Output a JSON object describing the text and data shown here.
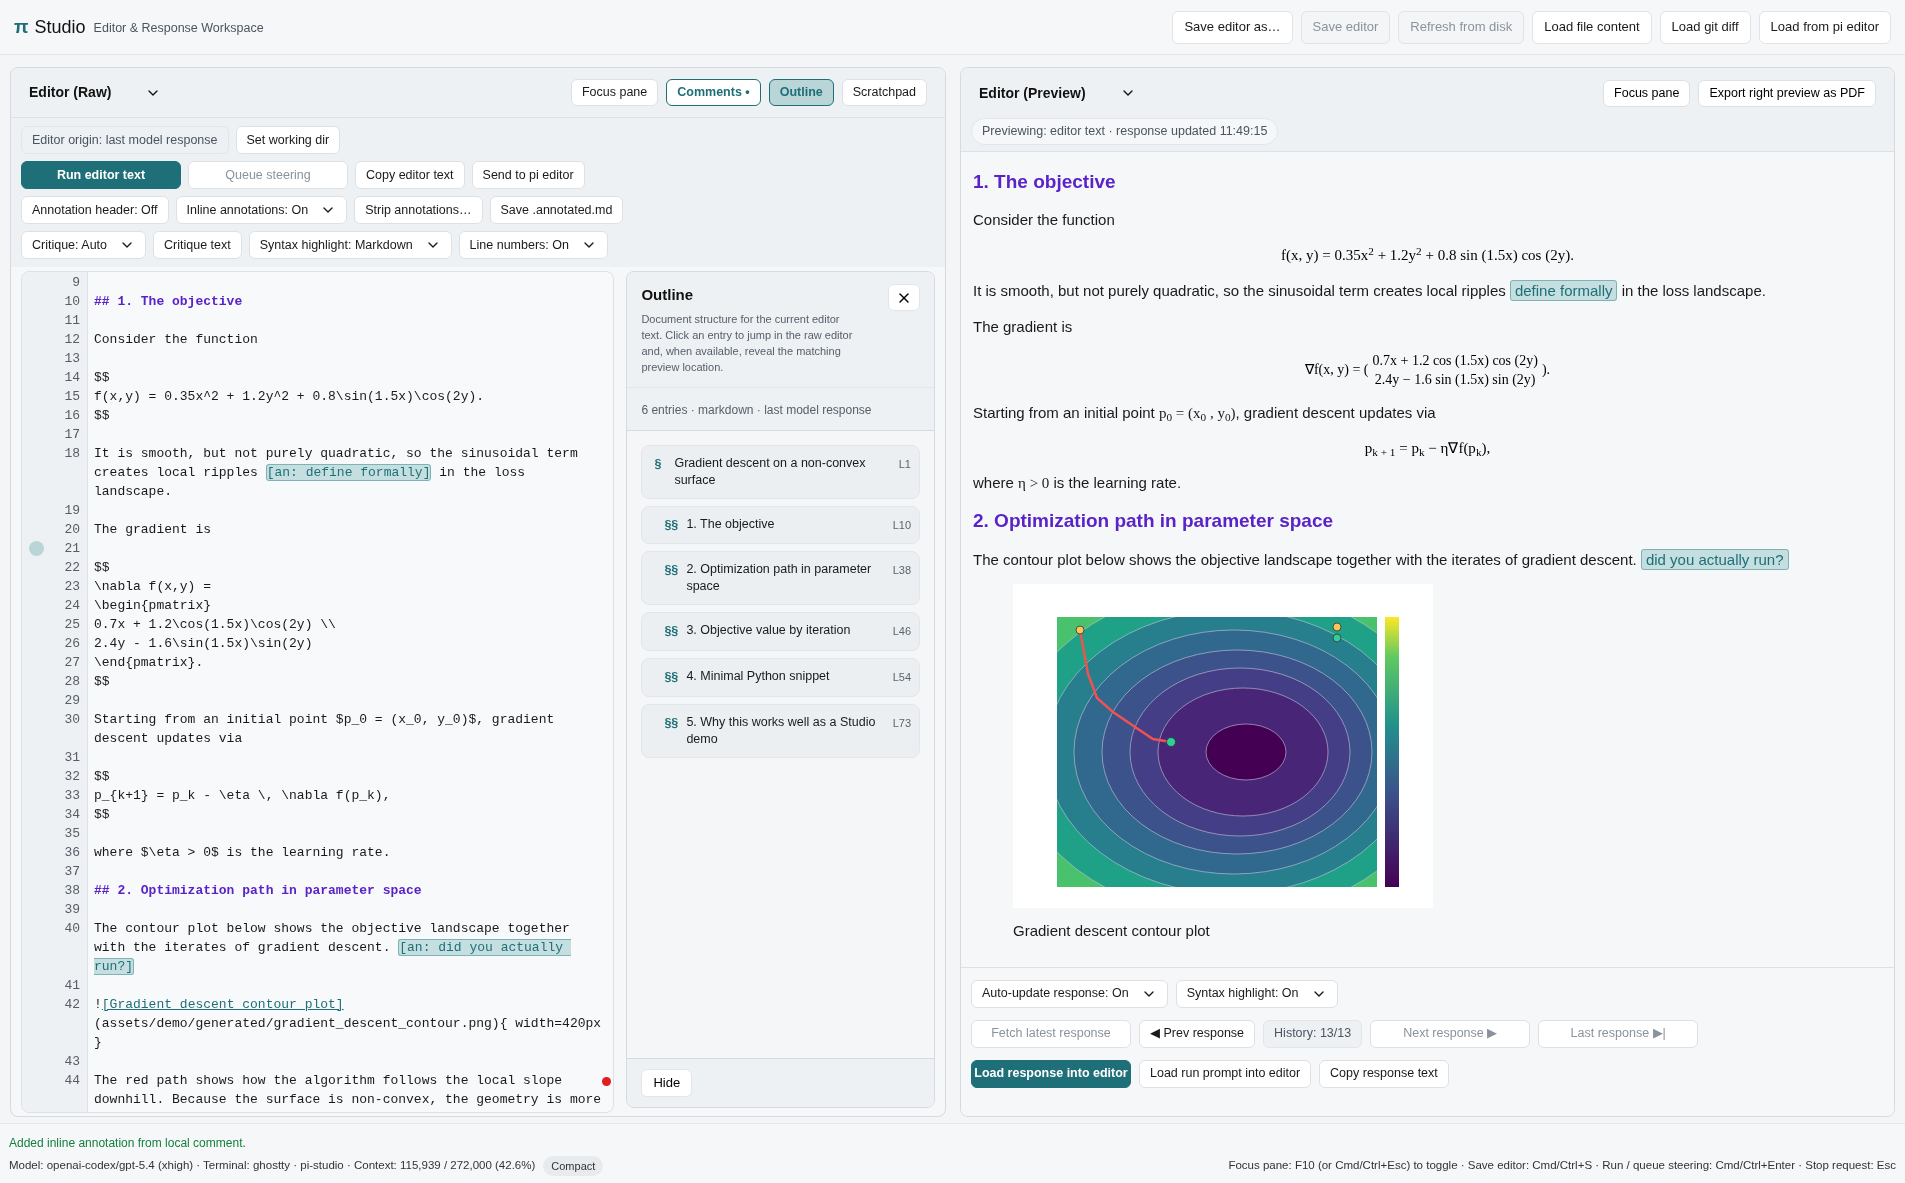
{
  "app": {
    "logo": "π",
    "title": "Studio",
    "subtitle": "Editor & Response Workspace"
  },
  "top_buttons": [
    {
      "label": "Save editor as…",
      "disabled": false
    },
    {
      "label": "Save editor",
      "disabled": true
    },
    {
      "label": "Refresh from disk",
      "disabled": true
    },
    {
      "label": "Load file content",
      "disabled": false
    },
    {
      "label": "Load git diff",
      "disabled": false
    },
    {
      "label": "Load from pi editor",
      "disabled": false
    }
  ],
  "editor": {
    "title": "Editor (Raw)",
    "header_buttons": [
      {
        "label": "Focus pane",
        "kind": "button"
      },
      {
        "label": "Comments •",
        "kind": "toggle",
        "on": true
      },
      {
        "label": "Outline",
        "kind": "panel",
        "on": true
      },
      {
        "label": "Scratchpad",
        "kind": "button"
      }
    ],
    "toolbar": [
      [
        {
          "kind": "pill",
          "label": "Editor origin: last model response"
        },
        {
          "kind": "button",
          "label": "Set working dir",
          "disabled": false
        }
      ],
      [
        {
          "kind": "primary",
          "label": "Run editor text",
          "disabled": false
        },
        {
          "kind": "button",
          "label": "Queue steering",
          "disabled": true
        },
        {
          "kind": "button",
          "label": "Copy editor text",
          "disabled": false
        },
        {
          "kind": "button",
          "label": "Send to pi editor",
          "disabled": false
        }
      ],
      [
        {
          "kind": "button",
          "label": "Annotation header: Off",
          "disabled": false
        },
        {
          "kind": "select",
          "label": "Inline annotations: On"
        },
        {
          "kind": "button",
          "label": "Strip annotations…",
          "disabled": false
        },
        {
          "kind": "button",
          "label": "Save .annotated.md",
          "disabled": false
        }
      ],
      [
        {
          "kind": "select",
          "label": "Critique: Auto"
        },
        {
          "kind": "button",
          "label": "Critique text",
          "disabled": false
        },
        {
          "kind": "select",
          "label": "Syntax highlight: Markdown"
        },
        {
          "kind": "select",
          "label": "Line numbers: On"
        }
      ]
    ],
    "lines": [
      {
        "n": "9"
      },
      {
        "n": "10",
        "tokens": [
          {
            "kind": "heading",
            "text": "## 1. The objective"
          }
        ]
      },
      {
        "n": "11"
      },
      {
        "n": "12",
        "tokens": [
          {
            "kind": "text",
            "text": "Consider the function"
          }
        ]
      },
      {
        "n": "13"
      },
      {
        "n": "14",
        "tokens": [
          {
            "kind": "text",
            "text": "$$"
          }
        ]
      },
      {
        "n": "15",
        "tokens": [
          {
            "kind": "text",
            "text": "f(x,y) = 0.35x^2 + 1.2y^2 + 0.8\\sin(1.5x)\\cos(2y)."
          }
        ]
      },
      {
        "n": "16",
        "tokens": [
          {
            "kind": "text",
            "text": "$$"
          }
        ]
      },
      {
        "n": "17"
      },
      {
        "n": "18",
        "tokens": [
          {
            "kind": "text",
            "text": "It is smooth, but not purely quadratic, so the sinusoidal term creates local ripples "
          },
          {
            "kind": "annotation",
            "text": "[an: define formally]"
          },
          {
            "kind": "text",
            "text": " in the loss landscape."
          }
        ]
      },
      {
        "n": "19"
      },
      {
        "n": "20",
        "tokens": [
          {
            "kind": "text",
            "text": "The gradient is"
          }
        ]
      },
      {
        "n": "21",
        "comment": true
      },
      {
        "n": "22",
        "tokens": [
          {
            "kind": "text",
            "text": "$$"
          }
        ]
      },
      {
        "n": "23",
        "tokens": [
          {
            "kind": "text",
            "text": "\\nabla f(x,y) ="
          }
        ]
      },
      {
        "n": "24",
        "tokens": [
          {
            "kind": "text",
            "text": "\\begin{pmatrix}"
          }
        ]
      },
      {
        "n": "25",
        "tokens": [
          {
            "kind": "text",
            "text": "0.7x + 1.2\\cos(1.5x)\\cos(2y) \\\\"
          }
        ]
      },
      {
        "n": "26",
        "tokens": [
          {
            "kind": "text",
            "text": "2.4y - 1.6\\sin(1.5x)\\sin(2y)"
          }
        ]
      },
      {
        "n": "27",
        "tokens": [
          {
            "kind": "text",
            "text": "\\end{pmatrix}."
          }
        ]
      },
      {
        "n": "28",
        "tokens": [
          {
            "kind": "text",
            "text": "$$"
          }
        ]
      },
      {
        "n": "29"
      },
      {
        "n": "30",
        "tokens": [
          {
            "kind": "text",
            "text": "Starting from an initial point $p_0 = (x_0, y_0)$, gradient descent updates via"
          }
        ]
      },
      {
        "n": "31"
      },
      {
        "n": "32",
        "tokens": [
          {
            "kind": "text",
            "text": "$$"
          }
        ]
      },
      {
        "n": "33",
        "tokens": [
          {
            "kind": "text",
            "text": "p_{k+1} = p_k - \\eta \\, \\nabla f(p_k),"
          }
        ]
      },
      {
        "n": "34",
        "tokens": [
          {
            "kind": "text",
            "text": "$$"
          }
        ]
      },
      {
        "n": "35"
      },
      {
        "n": "36",
        "tokens": [
          {
            "kind": "text",
            "text": "where $\\eta > 0$ is the learning rate."
          }
        ]
      },
      {
        "n": "37"
      },
      {
        "n": "38",
        "tokens": [
          {
            "kind": "heading",
            "text": "## 2. Optimization path in parameter space"
          }
        ]
      },
      {
        "n": "39"
      },
      {
        "n": "40",
        "tokens": [
          {
            "kind": "text",
            "text": "The contour plot below shows the objective landscape together with the iterates of gradient descent. "
          },
          {
            "kind": "annotation",
            "text": "[an: did you actually run?]"
          }
        ]
      },
      {
        "n": "41"
      },
      {
        "n": "42",
        "tokens": [
          {
            "kind": "text",
            "text": "!"
          },
          {
            "kind": "link",
            "text": "[Gradient descent contour plot]"
          },
          {
            "kind": "text",
            "text": "(assets/demo/generated/gradient_descent_contour.png){ width=420px }"
          }
        ]
      },
      {
        "n": "43"
      },
      {
        "n": "44",
        "flagged": true,
        "tokens": [
          {
            "kind": "text",
            "text": "The red path shows how the algorithm follows the local slope downhill. Because the surface is non-convex, the geometry is more"
          }
        ]
      }
    ]
  },
  "outline": {
    "title": "Outline",
    "description": "Document structure for the current editor text. Click an entry to jump in the raw editor and, when available, reveal the matching preview location.",
    "summary": "6 entries · markdown · last model response",
    "entries": [
      {
        "marker": "§",
        "text": "Gradient descent on a non-convex surface",
        "line": "L1",
        "children": [
          {
            "marker": "§§",
            "text": "1. The objective",
            "line": "L10"
          },
          {
            "marker": "§§",
            "text": "2. Optimization path in parameter space",
            "line": "L38"
          },
          {
            "marker": "§§",
            "text": "3. Objective value by iteration",
            "line": "L46"
          },
          {
            "marker": "§§",
            "text": "4. Minimal Python snippet",
            "line": "L54"
          },
          {
            "marker": "§§",
            "text": "5. Why this works well as a Studio demo",
            "line": "L73"
          }
        ]
      }
    ],
    "hide_button": "Hide"
  },
  "preview": {
    "title": "Editor (Preview)",
    "header_buttons": [
      "Focus pane",
      "Export right preview as PDF"
    ],
    "status": "Previewing: editor text · response updated 11:49:15",
    "blocks": [
      {
        "kind": "heading",
        "text": "1. The objective"
      },
      {
        "kind": "para",
        "tokens": [
          {
            "kind": "text",
            "text": "Consider the function"
          }
        ]
      },
      {
        "kind": "math",
        "text": "f(x, y) = 0.35x$^{2}$ + 1.2y$^{2}$ + 0.8 sin (1.5x) cos (2y)."
      },
      {
        "kind": "para",
        "tokens": [
          {
            "kind": "text",
            "text": "It is smooth, but not purely quadratic, so the sinusoidal term creates local ripples "
          },
          {
            "kind": "annotation",
            "text": "define formally"
          },
          {
            "kind": "text",
            "text": " in the loss landscape."
          }
        ]
      },
      {
        "kind": "para",
        "tokens": [
          {
            "kind": "text",
            "text": "The gradient is"
          }
        ]
      },
      {
        "kind": "matrix",
        "lhs": "∇f(x, y) = (",
        "rows": [
          "0.7x + 1.2 cos (1.5x) cos (2y)",
          "2.4y − 1.6 sin (1.5x) sin (2y)"
        ],
        "rhs": ")."
      },
      {
        "kind": "para",
        "tokens": [
          {
            "kind": "text",
            "text": "Starting from an initial point "
          },
          {
            "kind": "math",
            "text": "p$_{0}$ = (x$_{0}$ , y$_{0}$)"
          },
          {
            "kind": "text",
            "text": ", gradient descent updates via"
          }
        ]
      },
      {
        "kind": "math",
        "text": "p$_{k + 1}$ = p$_{k}$ − η∇f(p$_{k}$),"
      },
      {
        "kind": "para",
        "tokens": [
          {
            "kind": "text",
            "text": "where "
          },
          {
            "kind": "math",
            "text": "η > 0"
          },
          {
            "kind": "text",
            "text": " is the learning rate."
          }
        ]
      },
      {
        "kind": "heading",
        "text": "2. Optimization path in parameter space"
      },
      {
        "kind": "para",
        "tokens": [
          {
            "kind": "text",
            "text": "The contour plot below shows the objective landscape together with the iterates of gradient descent. "
          },
          {
            "kind": "annotation",
            "text": "did you actually run?"
          }
        ]
      },
      {
        "kind": "figure",
        "caption": "Gradient descent contour plot"
      }
    ],
    "controls": [
      [
        {
          "kind": "select",
          "label": "Auto-update response: On"
        },
        {
          "kind": "select",
          "label": "Syntax highlight: On"
        }
      ],
      [
        {
          "kind": "button",
          "label": "Fetch latest response",
          "disabled": true
        },
        {
          "kind": "button",
          "label": "◀ Prev response",
          "disabled": false
        },
        {
          "kind": "pill",
          "label": "History: 13/13"
        },
        {
          "kind": "button",
          "label": "Next response ▶",
          "disabled": true
        },
        {
          "kind": "button",
          "label": "Last response ▶|",
          "disabled": true
        }
      ],
      [
        {
          "kind": "primary",
          "label": "Load response into editor",
          "disabled": false
        },
        {
          "kind": "button",
          "label": "Load run prompt into editor",
          "disabled": false
        },
        {
          "kind": "button",
          "label": "Copy response text",
          "disabled": false
        }
      ]
    ]
  },
  "status_bar": {
    "message": "Added inline annotation from local comment.",
    "info": "Model: openai-codex/gpt-5.4 (xhigh) · Terminal: ghostty · pi-studio · Context: 115,939 / 272,000 (42.6%)",
    "compact_button": "Compact",
    "shortcuts": "Focus pane: F10 (or Cmd/Ctrl+Esc) to toggle · Save editor: Cmd/Ctrl+S · Run / queue steering: Cmd/Ctrl+Enter · Stop request: Esc"
  }
}
